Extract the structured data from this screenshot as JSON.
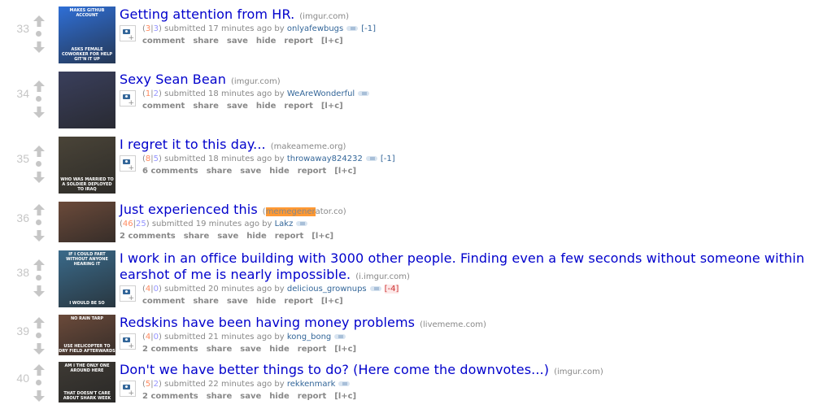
{
  "colors": {
    "title": "#0000cc",
    "upvotes": "#ff8b60",
    "downvotes": "#9494ff",
    "author": "#336699",
    "meta": "#888888",
    "rank": "#c6c6c6",
    "highlight": "#ff9933"
  },
  "posts": [
    {
      "rank": "33",
      "title": "Getting attention from HR.",
      "domain": "(imgur.com)",
      "up": "3",
      "down": "3",
      "submitted": "submitted 17 minutes ago by",
      "author": "onlyafewbugs",
      "karma_delta": "[-1]",
      "has_expando": true,
      "comments": "comment",
      "buttons": [
        "share",
        "save",
        "hide",
        "report",
        "[l+c]"
      ],
      "thumb_caption_top": "makes github account",
      "thumb_caption_bottom": "asks female coworker for help git'n it up",
      "thumb_color": "#2f6fd6"
    },
    {
      "rank": "34",
      "title": "Sexy Sean Bean",
      "domain": "(imgur.com)",
      "up": "1",
      "down": "2",
      "submitted": "submitted 18 minutes ago by",
      "author": "WeAreWonderful",
      "karma_delta": "",
      "has_expando": true,
      "comments": "comment",
      "buttons": [
        "share",
        "save",
        "hide",
        "report",
        "[l+c]"
      ],
      "thumb_caption_top": "",
      "thumb_caption_bottom": "",
      "thumb_color": "#3a3f5c"
    },
    {
      "rank": "35",
      "title": "I regret it to this day...",
      "domain": "(makeameme.org)",
      "up": "8",
      "down": "5",
      "submitted": "submitted 18 minutes ago by",
      "author": "throwaway824232",
      "karma_delta": "[-1]",
      "has_expando": true,
      "comments": "6 comments",
      "buttons": [
        "share",
        "save",
        "hide",
        "report",
        "[l+c]"
      ],
      "thumb_caption_top": "",
      "thumb_caption_bottom": "who was married to a soldier deployed to iraq",
      "thumb_color": "#4a4438"
    },
    {
      "rank": "36",
      "title": "Just experienced this",
      "domain_highlight": "memegener",
      "domain_rest": "ator.co)",
      "domain_prefix": "(",
      "up": "46",
      "down": "25",
      "submitted": "submitted 19 minutes ago by",
      "author": "Lakz",
      "karma_delta": "",
      "has_expando": false,
      "comments": "2 comments",
      "buttons": [
        "share",
        "save",
        "hide",
        "report",
        "[l+c]"
      ],
      "thumb_caption_top": "",
      "thumb_caption_bottom": "",
      "thumb_color": "#6b4a3a"
    },
    {
      "rank": "38",
      "title": "I work in an office building with 3000 other people. Finding even a few seconds without someone within earshot of me is nearly impossible.",
      "domain": "(i.imgur.com)",
      "up": "4",
      "down": "0",
      "submitted": "submitted 20 minutes ago by",
      "author": "delicious_grownups",
      "karma_delta": "[-4]",
      "has_expando": true,
      "comments": "comment",
      "buttons": [
        "share",
        "save",
        "hide",
        "report",
        "[l+c]"
      ],
      "thumb_caption_top": "if i could fart without anyone hearing it",
      "thumb_caption_bottom": "i would be so",
      "thumb_color": "#3a6a8a"
    },
    {
      "rank": "39",
      "title": "Redskins have been having money problems",
      "domain": "(livememe.com)",
      "up": "4",
      "down": "0",
      "submitted": "submitted 21 minutes ago by",
      "author": "kong_bong",
      "karma_delta": "",
      "has_expando": true,
      "comments": "2 comments",
      "buttons": [
        "share",
        "save",
        "hide",
        "report",
        "[l+c]"
      ],
      "thumb_caption_top": "no rain tarp",
      "thumb_caption_bottom": "use helicopter to dry field afterwards",
      "thumb_color": "#6b4a3a"
    },
    {
      "rank": "40",
      "title": "Don't we have better things to do? (Here come the downvotes...)",
      "domain": "(imgur.com)",
      "up": "5",
      "down": "2",
      "submitted": "submitted 22 minutes ago by",
      "author": "rekkenmark",
      "karma_delta": "",
      "has_expando": true,
      "comments": "2 comments",
      "buttons": [
        "share",
        "save",
        "hide",
        "report",
        "[l+c]"
      ],
      "thumb_caption_top": "am i the only one around here",
      "thumb_caption_bottom": "that doesn't care about shark week",
      "thumb_color": "#3e3a34"
    }
  ]
}
